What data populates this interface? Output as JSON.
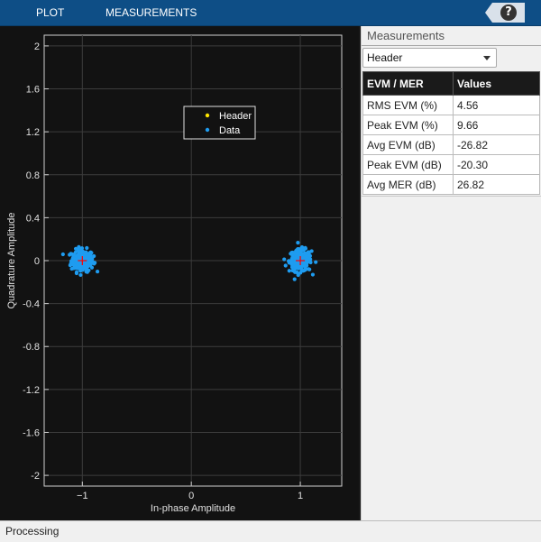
{
  "toolstrip": {
    "tabs": [
      "PLOT",
      "MEASUREMENTS"
    ],
    "help_label": "?"
  },
  "colors": {
    "header": "#ffe600",
    "data": "#1e9cf0",
    "reference": "#ff0000",
    "toolstrip": "#0e4e86"
  },
  "chart_data": {
    "type": "scatter",
    "title": "",
    "xlabel": "In-phase Amplitude",
    "ylabel": "Quadrature Amplitude",
    "xlim": [
      -1.35,
      1.38
    ],
    "ylim": [
      -2.1,
      2.1
    ],
    "xticks": [
      -1,
      0,
      1
    ],
    "yticks": [
      2,
      1.6,
      1.2,
      0.8,
      0.4,
      0,
      -0.4,
      -0.8,
      -1.2,
      -1.6,
      -2
    ],
    "grid": true,
    "legend": {
      "position": "top-center",
      "entries": [
        "Header",
        "Data"
      ]
    },
    "series": [
      {
        "name": "Header",
        "color": "#ffe600",
        "points": []
      },
      {
        "name": "Data",
        "color": "#1e9cf0",
        "clusters": [
          {
            "center": [
              -1,
              0
            ],
            "spread": 0.06
          },
          {
            "center": [
              1,
              0
            ],
            "spread": 0.06
          }
        ]
      }
    ],
    "reference_points": [
      [
        -1,
        0
      ],
      [
        1,
        0
      ]
    ]
  },
  "measurements": {
    "title": "Measurements",
    "dropdown": "Header",
    "table": {
      "headers": [
        "EVM / MER",
        "Values"
      ],
      "rows": [
        [
          "RMS EVM (%)",
          "4.56"
        ],
        [
          "Peak EVM (%)",
          "9.66"
        ],
        [
          "Avg EVM (dB)",
          "-26.82"
        ],
        [
          "Peak EVM (dB)",
          "-20.30"
        ],
        [
          "Avg MER (dB)",
          "26.82"
        ]
      ]
    }
  },
  "status": "Processing"
}
